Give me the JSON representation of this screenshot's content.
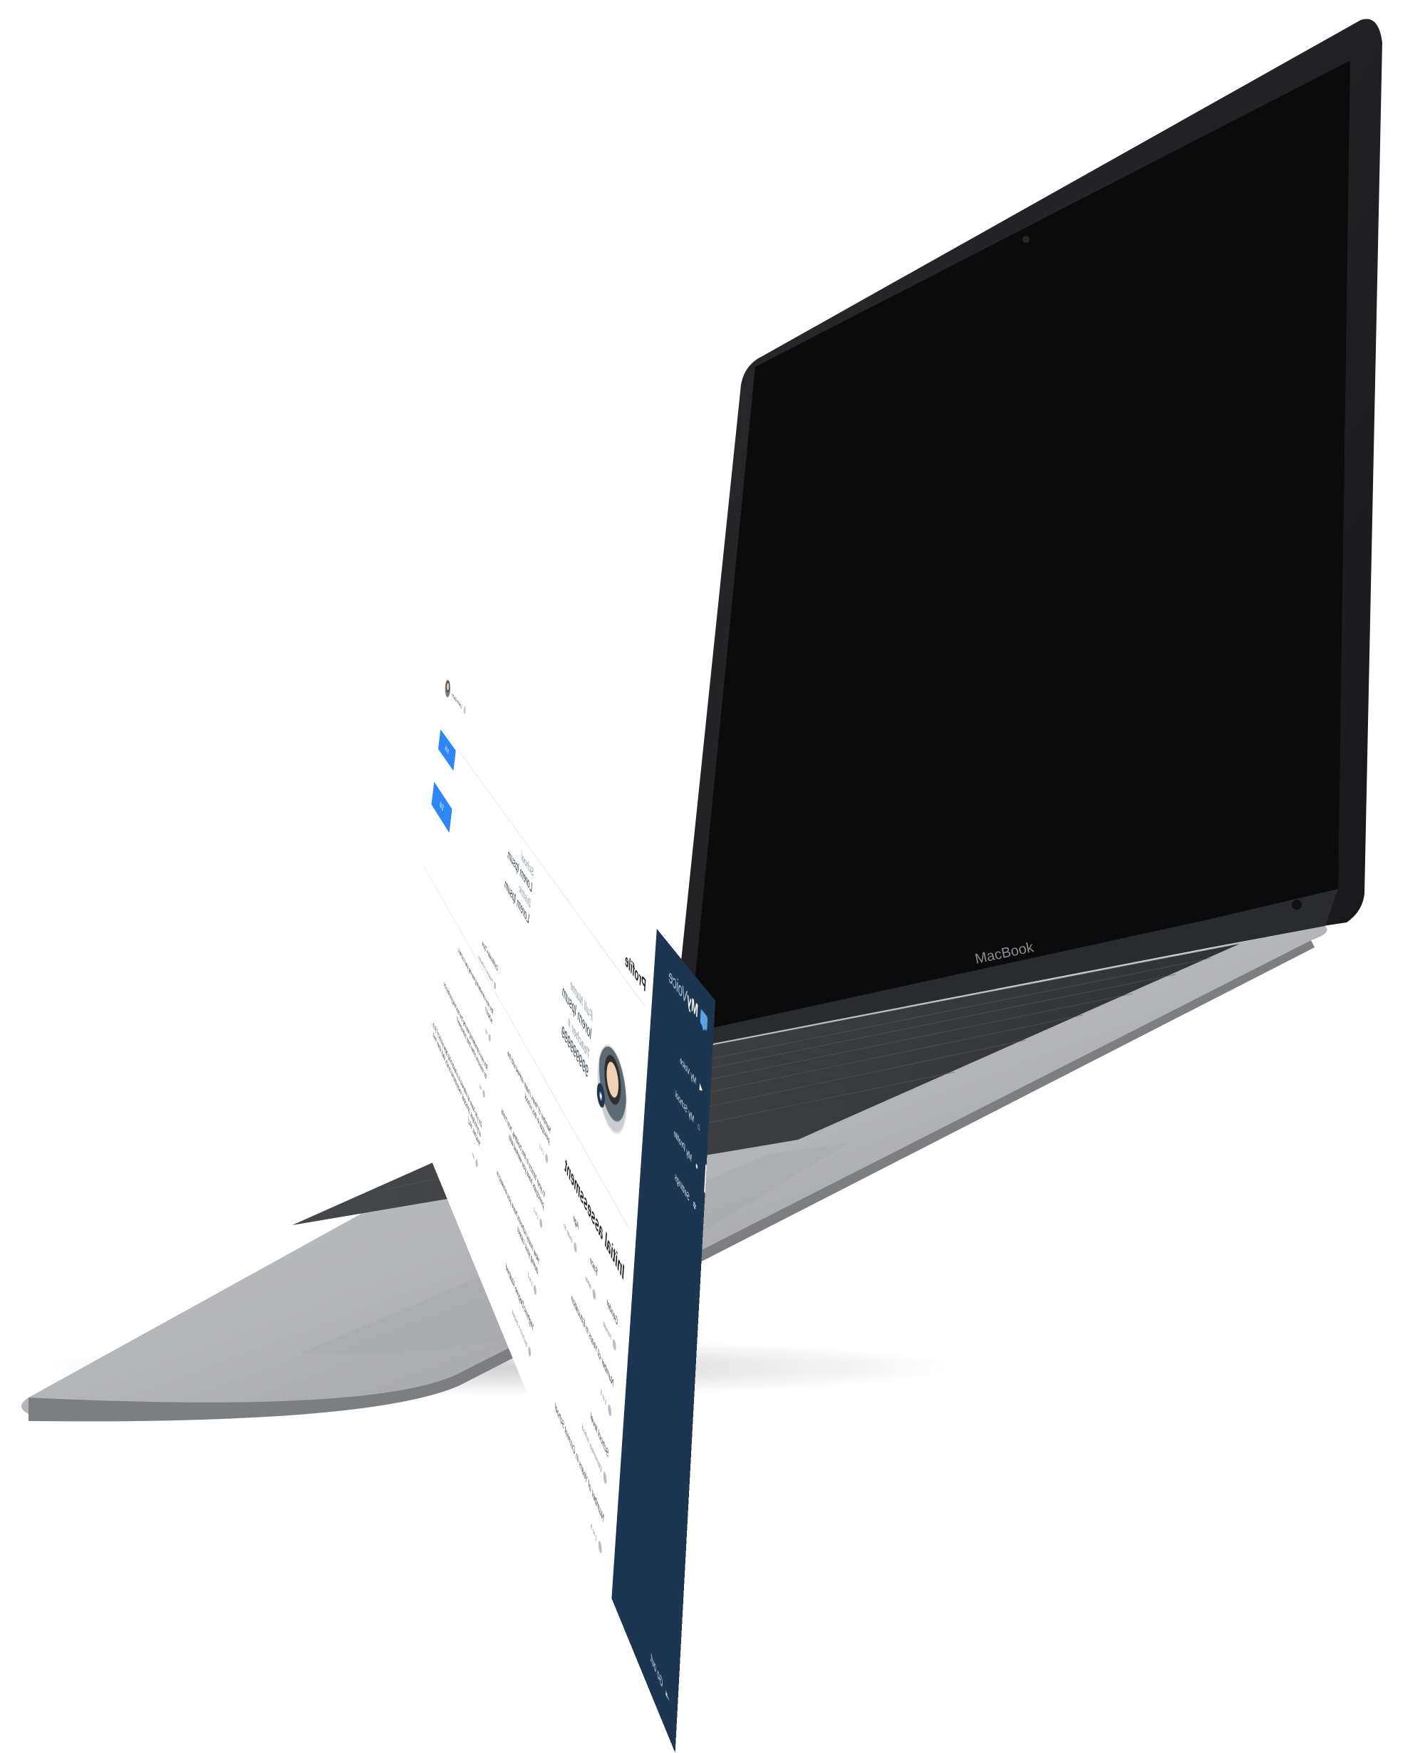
{
  "device": {
    "brand": "MacBook"
  },
  "sidebar": {
    "logo": {
      "bold": "My",
      "light": "Voice"
    },
    "items": [
      {
        "label": "My Voice",
        "icon": "megaphone-icon"
      },
      {
        "label": "My School",
        "icon": "home-icon"
      },
      {
        "label": "My Profile",
        "icon": "user-icon",
        "active": true
      },
      {
        "label": "Settings",
        "icon": "gear-icon"
      }
    ],
    "logout": "Go out"
  },
  "topbar": {
    "username": "Lorem Ipsum"
  },
  "profile": {
    "title": "Profile",
    "edit_top": "Edit",
    "edit_mid": "Edit",
    "fields": {
      "full_name_label": "Full Name",
      "full_name_value": "lorem Ipsum",
      "teacher_label": "Teacher #",
      "teacher_value": "999999999",
      "school_label": "School",
      "school_value": "Lorem Ipsum",
      "district_label": "Distric",
      "district_value": "Lorem Ipsum"
    }
  },
  "assessment": {
    "title": "Initial assessment",
    "gender": {
      "q": "Gender",
      "a": "Female"
    },
    "race": {
      "q": "Race",
      "a": "White"
    },
    "age": {
      "q": "Age",
      "a": "Under 30"
    },
    "years_education": {
      "q": "Number of Years in Education",
      "a": "1 to 5"
    },
    "school_level": {
      "q": "School level",
      "a": "Elementary School"
    },
    "years_current": {
      "q": "Number of Years in Current School",
      "a": "1 to 5"
    },
    "years_principal": {
      "q": "Number of Years I have worked with the principal in this school",
      "a": "1 to 2"
    },
    "principals": {
      "q": "In your tenure in this building, how many principals have you worked with",
      "a": "1 to 2"
    },
    "schools": {
      "q": "How many schools have you worked in during your career",
      "a": "1 to 2"
    },
    "degree": {
      "q": "Highest Degree Attained",
      "a": "Bachelor's Degree"
    },
    "cert": {
      "q": "Certification Type",
      "a": "Traditional Certification"
    },
    "leaving_school": {
      "q": "Are you considering leaving your current school?",
      "a": "Yes"
    },
    "leaving_profession": {
      "q": "Are you considering leaving the teaching profession for seasons other than retirement?",
      "a": "Yes"
    },
    "leadership": {
      "q": "Do you have an interest in a leadership-type position? [e.g., a/ principal, principal, instructional coach, dept chair, lead teacher, etc.]",
      "a": "Yes"
    }
  }
}
